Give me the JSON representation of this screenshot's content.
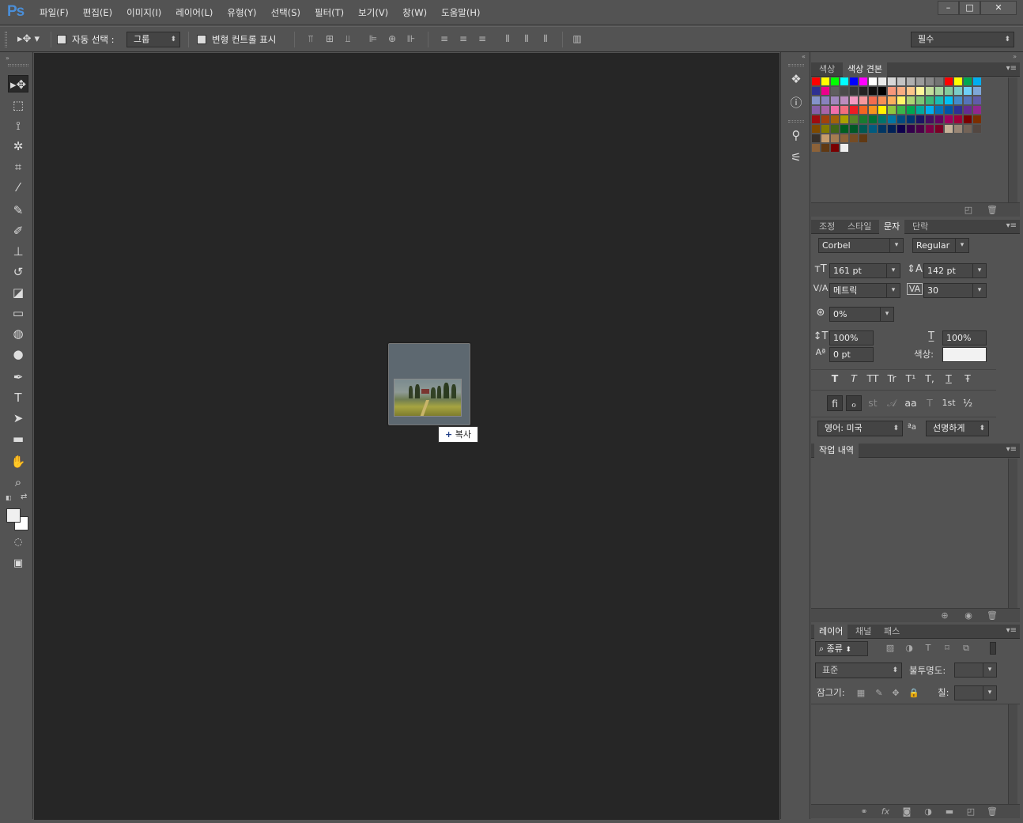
{
  "app": {
    "logo": "Ps"
  },
  "menu": [
    "파일(F)",
    "편집(E)",
    "이미지(I)",
    "레이어(L)",
    "유형(Y)",
    "선택(S)",
    "필터(T)",
    "보기(V)",
    "창(W)",
    "도움말(H)"
  ],
  "window_controls": {
    "minimize": "–",
    "maximize": "□",
    "close": "✕"
  },
  "options": {
    "auto_select_label": "자동 선택 :",
    "auto_select_value": "그룹",
    "transform_label": "변형 컨트롤 표시",
    "workspace": "필수"
  },
  "canvas": {
    "drag_tip": "복사",
    "drag_tip_plus": "+"
  },
  "swatches_panel": {
    "tabs": [
      "색상",
      "색상 견본"
    ],
    "active": 1,
    "rows": [
      [
        "#ff0000",
        "#ffff00",
        "#00ff00",
        "#00ffff",
        "#0000ff",
        "#ff00ff",
        "#ffffff",
        "#ebebeb",
        "#d7d7d7",
        "#c3c3c3",
        "#afafaf",
        "#9b9b9b",
        "#878787",
        "#737373",
        "#ff0000",
        "#ffff00",
        "#00a651",
        "#00aeef"
      ],
      [
        "#2e3192",
        "#ec008c",
        "#5f5f5f",
        "#4b4b4b",
        "#373737",
        "#232323",
        "#0f0f0f",
        "#000000",
        "#f7977a",
        "#f9ad81",
        "#fdc68a",
        "#fff79a",
        "#c4df9b",
        "#a3d39c",
        "#82ca9d",
        "#7bcdc8",
        "#6ecff6",
        "#7ea7d8"
      ],
      [
        "#8493ca",
        "#8882be",
        "#a187be",
        "#bc8dbf",
        "#f49ac2",
        "#f6989d",
        "#f26c4f",
        "#f68e56",
        "#fbaf5d",
        "#fff568",
        "#acd373",
        "#7cc576",
        "#3bb878",
        "#1abbb4",
        "#00bff3",
        "#438ccb",
        "#5574b9",
        "#605ca8"
      ],
      [
        "#855fa8",
        "#a864a8",
        "#f06eaa",
        "#f26d7d",
        "#ed1c24",
        "#f26522",
        "#f7941d",
        "#fff200",
        "#8dc63f",
        "#39b54a",
        "#00a651",
        "#00a99d",
        "#00aeef",
        "#0072bc",
        "#0054a6",
        "#2e3192",
        "#662d91",
        "#92278f"
      ],
      [
        "#9e0b0f",
        "#a0410d",
        "#a36209",
        "#aba000",
        "#598527",
        "#197b30",
        "#007236",
        "#00746b",
        "#0076a3",
        "#004b80",
        "#003471",
        "#1b1464",
        "#440e62",
        "#630460",
        "#9e005d",
        "#9e0039",
        "#790000",
        "#7b2e00"
      ],
      [
        "#7d4900",
        "#827b00",
        "#406618",
        "#005e20",
        "#005826",
        "#005952",
        "#005b7f",
        "#003663",
        "#002157",
        "#0d004c",
        "#32004b",
        "#4b0049",
        "#7b0046",
        "#7a0026",
        "#c7b299",
        "#998675",
        "#736357",
        "#534741"
      ],
      [
        "#37302a",
        "#c69c6d",
        "#a67c52",
        "#8c6239",
        "#754c24",
        "#603913"
      ],
      [
        "#8c6239",
        "#603913",
        "#790000",
        "#f0f0f0"
      ]
    ]
  },
  "character_panel": {
    "tabs": [
      "조정",
      "스타일",
      "문자",
      "단락"
    ],
    "active": 2,
    "font_family": "Corbel",
    "font_style": "Regular",
    "size": "161 pt",
    "leading": "142 pt",
    "kerning": "메트릭",
    "tracking": "30",
    "scale_pct": "0%",
    "vert_scale": "100%",
    "horiz_scale": "100%",
    "baseline": "0 pt",
    "color_label": "색상:",
    "language": "영어: 미국",
    "aa_label": "ªa",
    "antialias": "선명하게",
    "style_buttons": [
      "T",
      "T",
      "TT",
      "Tr",
      "T¹",
      "T,",
      "T",
      "Ŧ"
    ],
    "ot_buttons": [
      "fi",
      "ℴ",
      "st",
      "𝒜",
      "aa",
      "T",
      "1st",
      "½"
    ]
  },
  "history_panel": {
    "tabs": [
      "작업 내역"
    ],
    "active": 0
  },
  "layers_panel": {
    "tabs": [
      "레이어",
      "채널",
      "패스"
    ],
    "active": 0,
    "filter_label": "종류",
    "blend_mode": "표준",
    "opacity_label": "불투명도:",
    "lock_label": "잠그기:",
    "fill_label": "칠:"
  }
}
